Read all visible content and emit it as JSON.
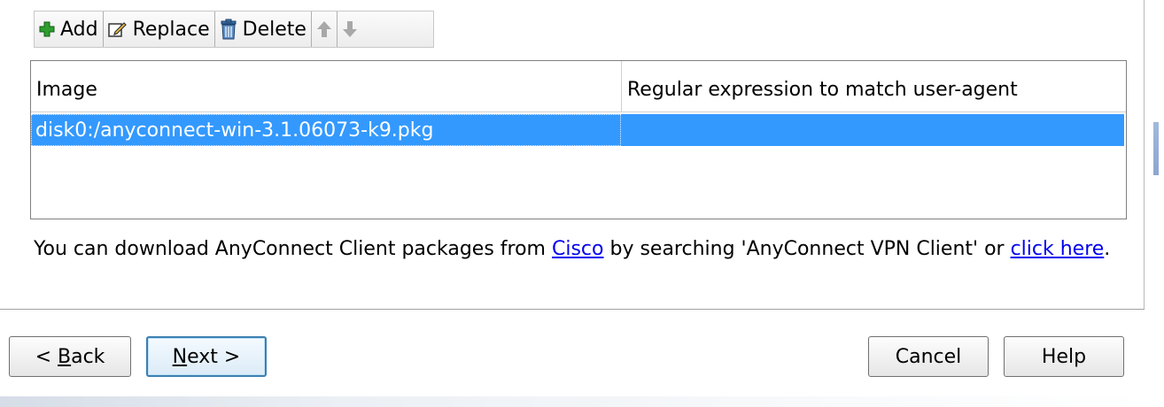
{
  "toolbar": {
    "add_label": "Add",
    "replace_label": "Replace",
    "delete_label": "Delete"
  },
  "table": {
    "columns": [
      "Image",
      "Regular expression to match user-agent"
    ],
    "rows": [
      [
        "disk0:/anyconnect-win-3.1.06073-k9.pkg",
        ""
      ]
    ]
  },
  "info": {
    "text_before": "You can download AnyConnect Client packages from ",
    "link_cisco": "Cisco",
    "text_middle": " by searching 'AnyConnect VPN Client' or ",
    "link_click_here": "click here",
    "text_after": "."
  },
  "buttons": {
    "back_prefix": "< ",
    "back_mnemonic": "B",
    "back_rest": "ack",
    "next_mnemonic": "N",
    "next_rest": "ext >",
    "cancel": "Cancel",
    "help": "Help"
  },
  "colors": {
    "selection": "#3399ff",
    "link": "#0000ee",
    "add_icon": "#2e9e2e"
  }
}
